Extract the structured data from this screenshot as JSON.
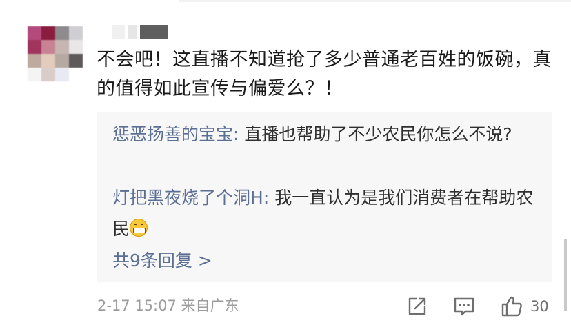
{
  "comment": {
    "text": "不会吧！这直播不知道抢了多少普通老百姓的饭碗，真的值得如此宣传与偏爱么？！"
  },
  "replies": [
    {
      "author": "惩恶扬善的宝宝",
      "separator": ": ",
      "text": "直播也帮助了不少农民你怎么不说?"
    },
    {
      "author": "灯把黑夜烧了个洞H",
      "separator": ": ",
      "text": "我一直认为是我们消费者在帮助农民",
      "emoji": "grinning-face-emoji"
    }
  ],
  "more_replies": "共9条回复 >",
  "meta": {
    "time": "2-17 15:07",
    "location": "来自广东"
  },
  "actions": {
    "like_count": "30"
  },
  "colors": {
    "link_blue": "#5b6f95",
    "text": "#1a1a1a",
    "reply_bg": "#f7f7f7",
    "meta_gray": "#9c9c9c"
  }
}
